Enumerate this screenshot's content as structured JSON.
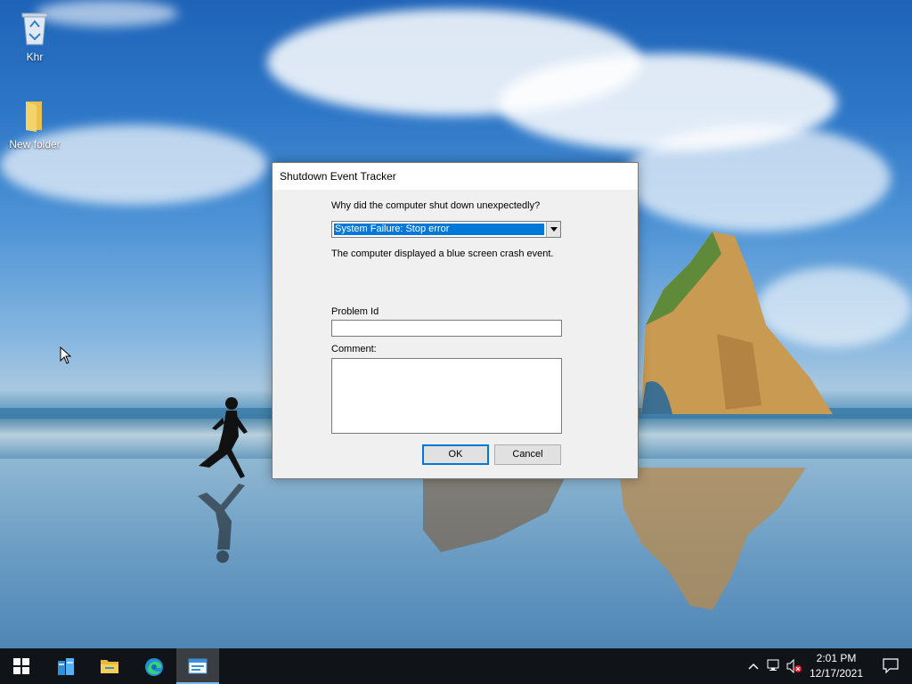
{
  "desktop": {
    "icons": [
      {
        "label": "Khr",
        "icon": "recycle-bin-icon"
      },
      {
        "label": "New folder",
        "icon": "folder-icon"
      }
    ]
  },
  "dialog": {
    "title": "Shutdown Event Tracker",
    "question": "Why did the computer shut down unexpectedly?",
    "reason_selected": "System Failure: Stop error",
    "description": "The computer displayed a blue screen crash event.",
    "problem_id_label": "Problem Id",
    "problem_id_value": "",
    "comment_label": "Comment:",
    "comment_value": "",
    "ok_label": "OK",
    "cancel_label": "Cancel",
    "selection_color": "#0078d7"
  },
  "taskbar": {
    "items": [
      "start-icon",
      "server-manager-icon",
      "file-explorer-icon",
      "edge-icon",
      "shutdown-tracker-app-icon"
    ],
    "clock_time": "2:01 PM",
    "clock_date": "12/17/2021"
  }
}
